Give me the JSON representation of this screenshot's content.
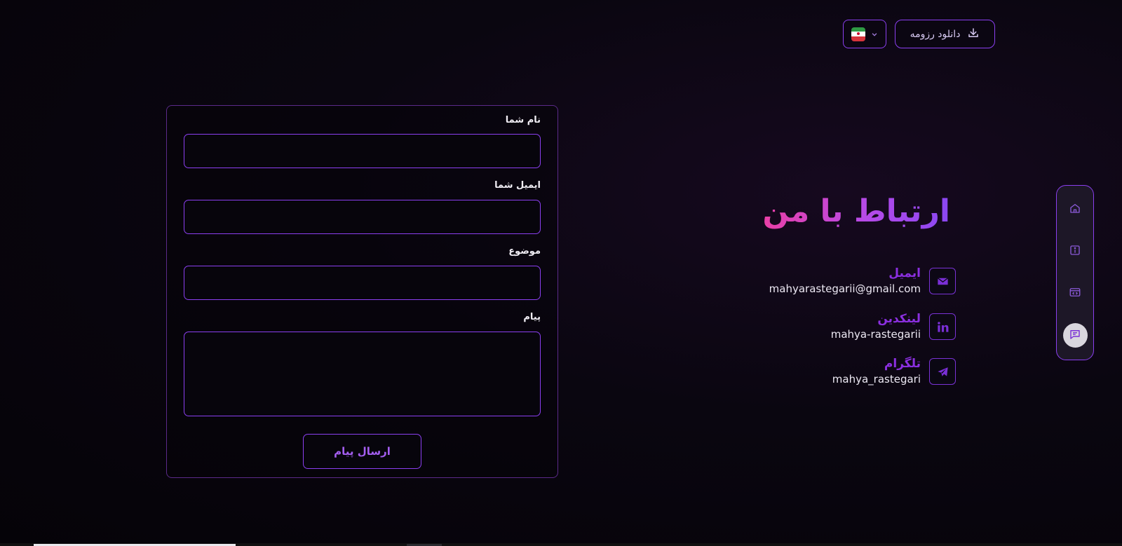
{
  "header": {
    "resume_label": "دانلود رزومه",
    "language_flag": "iran-flag"
  },
  "contact": {
    "title": "ارتباط با من",
    "items": [
      {
        "label": "ایمیل",
        "value": "mahyarastegarii@gmail.com",
        "icon": "mail-icon"
      },
      {
        "label": "لینکدین",
        "value": "mahya-rastegarii",
        "icon": "linkedin-icon"
      },
      {
        "label": "تلگرام",
        "value": "mahya_rastegari",
        "icon": "telegram-icon"
      }
    ]
  },
  "form": {
    "name_label": "نام شما",
    "name_value": "",
    "email_label": "ایمیل شما",
    "email_value": "",
    "subject_label": "موضوع",
    "subject_value": "",
    "message_label": "پیام",
    "message_value": "",
    "submit_label": "ارسال پیام"
  },
  "side_nav": {
    "items": [
      {
        "icon": "home-icon",
        "active": false
      },
      {
        "icon": "info-icon",
        "active": false
      },
      {
        "icon": "code-window-icon",
        "active": false
      },
      {
        "icon": "chat-icon",
        "active": true
      }
    ]
  },
  "colors": {
    "accent": "#8b3ff0",
    "title_gradient_start": "#ea3fa6",
    "title_gradient_end": "#8a47f2",
    "label_purple": "#8b2fe0",
    "background": "#0a0610"
  }
}
